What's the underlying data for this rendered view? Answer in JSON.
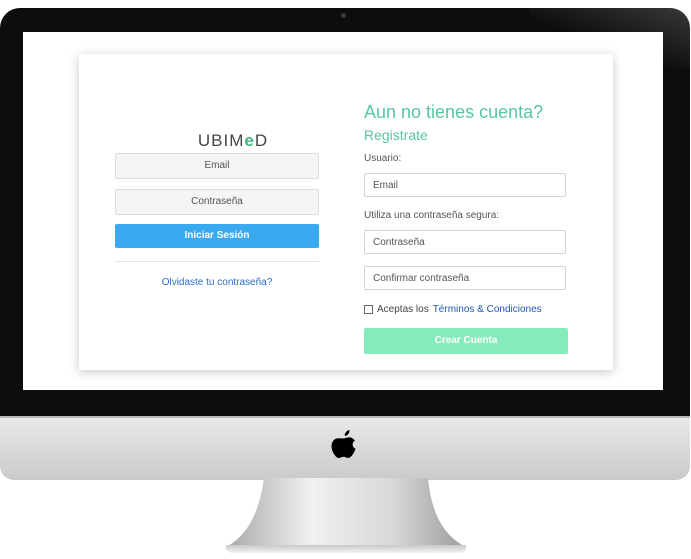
{
  "login": {
    "logo_prefix": "UBIM",
    "logo_mid": "e",
    "logo_suffix": "D",
    "email_placeholder": "Email",
    "password_placeholder": "Contraseña",
    "login_button": "Iniciar Sesión",
    "forgot_link": "Olvidaste tu contraseña?"
  },
  "register": {
    "title": "Aun no tienes cuenta?",
    "subtitle": "Registrate",
    "user_label": "Usuario:",
    "email_placeholder": "Email",
    "password_hint": "Utiliza una contraseña segura:",
    "password_placeholder": "Contraseña",
    "confirm_placeholder": "Confirmar contraseña",
    "terms_prefix": "Aceptas los",
    "terms_link": "Términos & Condiciones",
    "terms_checked": false,
    "create_button": "Crear Cuenta"
  },
  "colors": {
    "login_button": "#3aaaf0",
    "create_button": "#86ebbc",
    "accent_green": "#58c6a0",
    "link": "#2c6fc4"
  },
  "icons": {
    "device_logo": "apple-icon"
  }
}
